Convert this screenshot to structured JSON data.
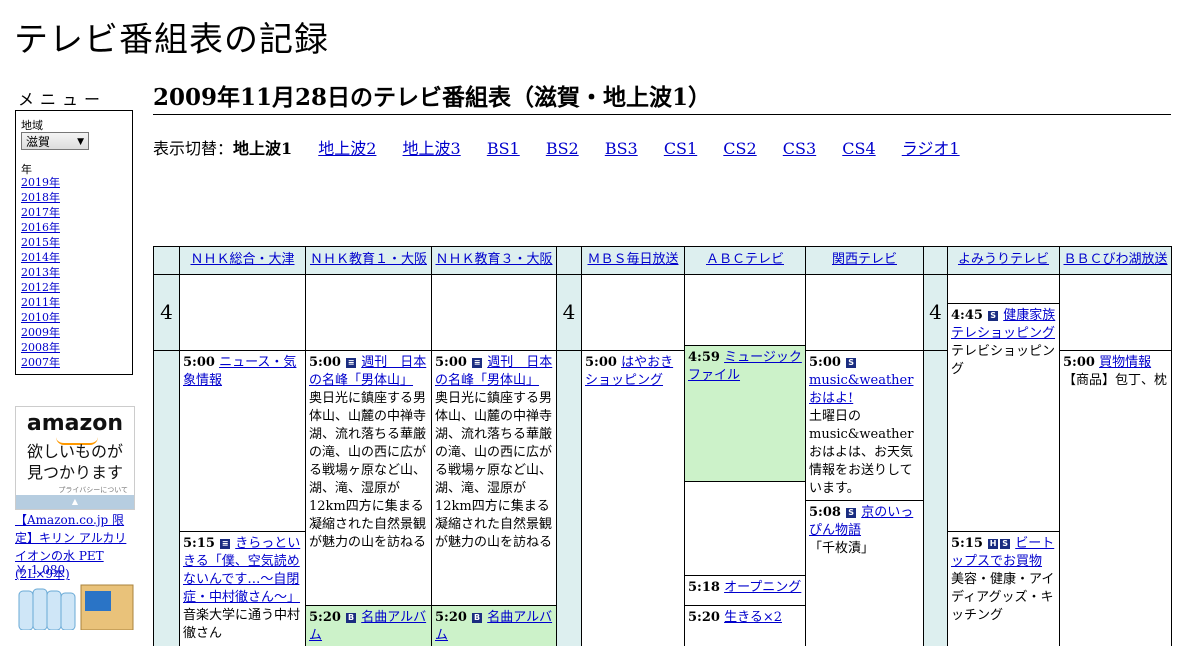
{
  "site": {
    "title": "テレビ番組表の記録"
  },
  "sidebar": {
    "menu_title": "メニュー",
    "region_label": "地域",
    "region_value": "滋賀",
    "year_label": "年",
    "years": [
      "2019年",
      "2018年",
      "2017年",
      "2016年",
      "2015年",
      "2014年",
      "2013年",
      "2012年",
      "2011年",
      "2010年",
      "2009年",
      "2008年",
      "2007年"
    ]
  },
  "ad": {
    "logo": "amazon",
    "tagline_1": "欲しいものが",
    "tagline_2": "見つかります",
    "privacy": "プライバシーについて",
    "product": "【Amazon.co.jp 限定】キリン アルカリイオンの水 PET (2L×9本)",
    "price": "￥ 1,080"
  },
  "main": {
    "heading": "2009年11月28日のテレビ番組表（滋賀・地上波1）",
    "switch_label": "表示切替：",
    "switch_current": "地上波1",
    "switch_links": [
      "地上波2",
      "地上波3",
      "BS1",
      "BS2",
      "BS3",
      "CS1",
      "CS2",
      "CS3",
      "CS4",
      "ラジオ1"
    ]
  },
  "schedule": {
    "hour": "4",
    "channels": [
      "ＮＨＫ総合・大津",
      "ＮＨＫ教育１・大阪",
      "ＮＨＫ教育３・大阪",
      "ＭＢＳ毎日放送",
      "ＡＢＣテレビ",
      "関西テレビ",
      "よみうりテレビ",
      "ＢＢＣびわ湖放送"
    ],
    "nhk_g": [
      {
        "time": "5:00",
        "title": "ニュース・気象情報",
        "desc": ""
      },
      {
        "time": "5:15",
        "title": "きらっといきる「僕、空気読めないんです…～自閉症・中村徹さん～」",
        "desc": "音楽大学に通う中村徹さん"
      }
    ],
    "etv1": [
      {
        "time": "5:00",
        "title": "週刊　日本の名峰「男体山」",
        "desc": "奥日光に鎮座する男体山、山麓の中禅寺湖、流れ落ちる華厳の滝、山の西に広がる戦場ヶ原など山、湖、滝、湿原が12km四方に集まる凝縮された自然景観が魅力の山を訪ねる"
      },
      {
        "time": "5:20",
        "title": "名曲アルバム",
        "desc": ""
      }
    ],
    "etv3": [
      {
        "time": "5:00",
        "title": "週刊　日本の名峰「男体山」",
        "desc": "奥日光に鎮座する男体山、山麓の中禅寺湖、流れ落ちる華厳の滝、山の西に広がる戦場ヶ原など山、湖、滝、湿原が12km四方に集まる凝縮された自然景観が魅力の山を訪ねる"
      },
      {
        "time": "5:20",
        "title": "名曲アルバム",
        "desc": ""
      }
    ],
    "mbs": [
      {
        "time": "5:00",
        "title": "はやおきショッピング",
        "desc": ""
      }
    ],
    "abc": [
      {
        "time": "4:59",
        "title": "ミュージックファイル",
        "desc": ""
      },
      {
        "time": "5:18",
        "title": "オープニング",
        "desc": ""
      },
      {
        "time": "5:20",
        "title": "生きる×2",
        "desc": ""
      }
    ],
    "ktv": [
      {
        "time": "5:00",
        "title": "music&weatherおはよ!",
        "desc": "土曜日のmusic&weatherおはよは、お天気情報をお送りしています。"
      },
      {
        "time": "5:08",
        "title": "京のいっぴん物語",
        "desc": "「千枚漬」"
      }
    ],
    "ytv": [
      {
        "time": "4:45",
        "title": "健康家族テレショッピング",
        "desc": "テレビショッピング"
      },
      {
        "time": "5:15",
        "title": "ビートップスでお買物",
        "desc": "美容・健康・アイディアグッズ・キッチング"
      }
    ],
    "bbc": [
      {
        "time": "5:00",
        "title": "買物情報",
        "desc": "【商品】包丁、枕"
      }
    ]
  }
}
